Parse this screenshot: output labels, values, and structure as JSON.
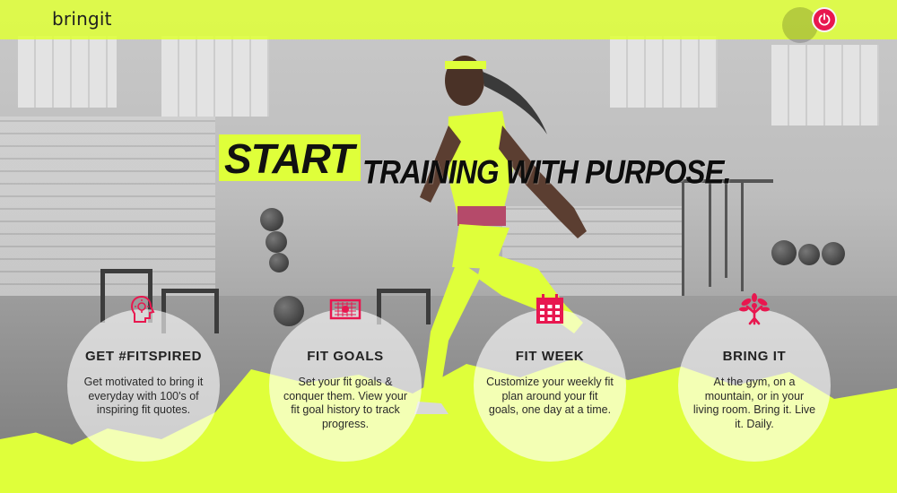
{
  "header": {
    "brand": "bringit",
    "power_icon": "power-icon"
  },
  "hero": {
    "highlight": "START",
    "tagline": "TRAINING WITH PURPOSE."
  },
  "features": [
    {
      "icon": "lightbulb-head-icon",
      "title": "GET #FITSPIRED",
      "description": "Get motivated to bring it everyday with 100's of inspiring fit quotes."
    },
    {
      "icon": "goal-net-icon",
      "title": "FIT GOALS",
      "description": "Set your fit goals & conquer them. View your fit goal history to track progress."
    },
    {
      "icon": "calendar-icon",
      "title": "FIT WEEK",
      "description": "Customize your weekly fit plan around your fit goals, one day at a time."
    },
    {
      "icon": "tree-person-icon",
      "title": "BRING IT",
      "description": "At the gym, on a mountain, or in your living room. Bring it. Live it. Daily."
    }
  ],
  "colors": {
    "accent": "#dfff3a",
    "brand_red": "#e8174f",
    "text_dark": "#111111"
  }
}
